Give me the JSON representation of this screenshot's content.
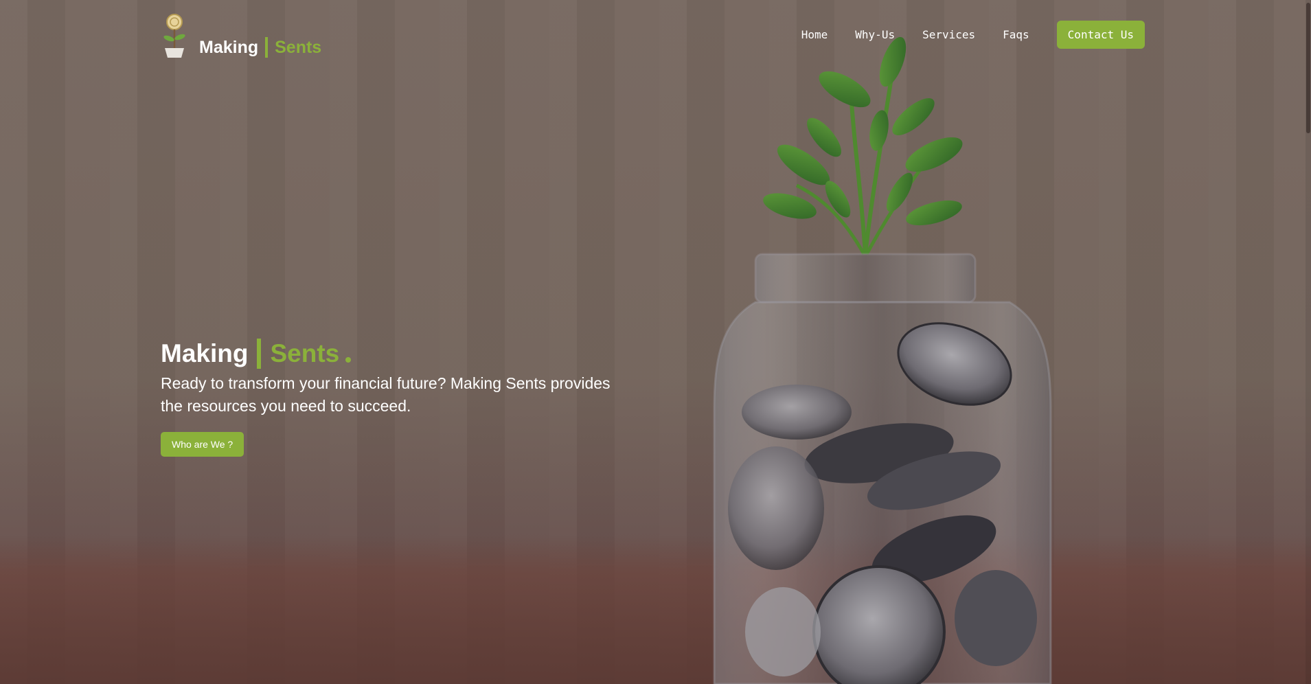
{
  "brand": {
    "name_part1": "Making",
    "name_part2": "Sents",
    "logo_icon": "money-plant-icon"
  },
  "nav": {
    "items": [
      {
        "label": "Home"
      },
      {
        "label": "Why-Us"
      },
      {
        "label": "Services"
      },
      {
        "label": "Faqs"
      }
    ],
    "contact_label": "Contact Us"
  },
  "hero": {
    "title_part1": "Making",
    "title_part2": "Sents",
    "description": "Ready to transform your financial future? Making Sents provides the resources you need to succeed.",
    "cta_label": "Who are We ?",
    "background_image": "coin-jar-with-plant-photo"
  },
  "colors": {
    "accent": "#8bb13a",
    "text": "#ffffff",
    "overlay": "#6e6058"
  }
}
